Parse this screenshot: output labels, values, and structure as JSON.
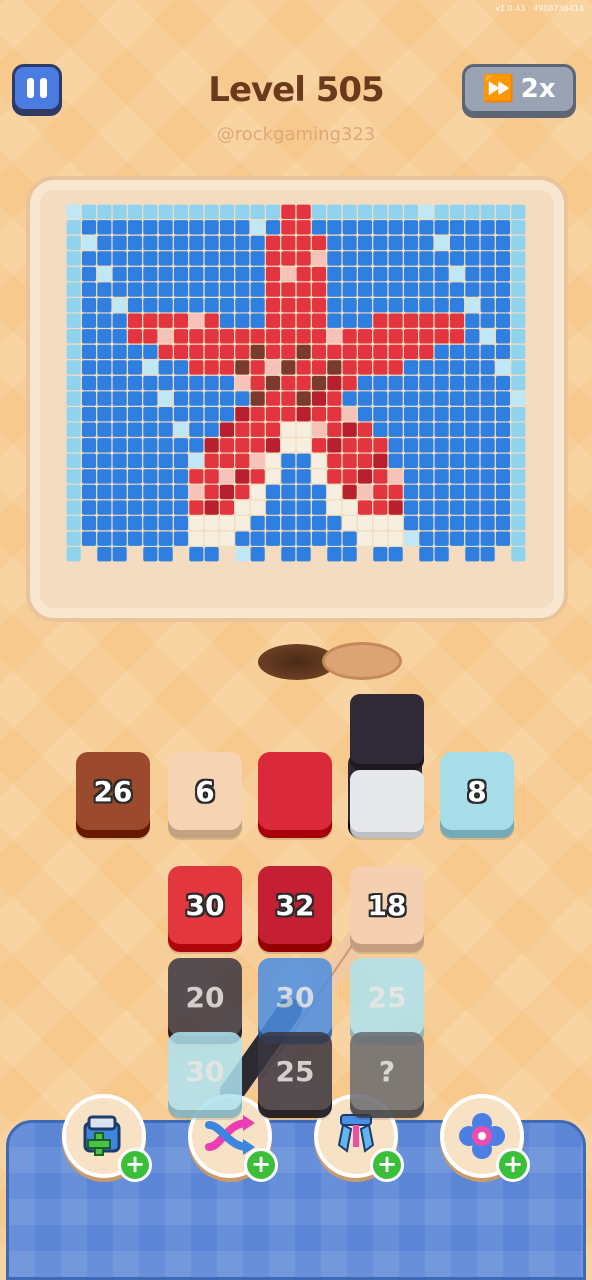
{
  "version": "v1.0.43 · 4908736414",
  "header": {
    "level_title": "Level 505",
    "speed_label": "2x"
  },
  "watermark": "@rockgaming323",
  "queue_tiles": [
    {
      "value": "26",
      "color": "#9b4a2e"
    },
    {
      "value": "6",
      "color": "#f6d3b3"
    },
    {
      "value": "",
      "color": "#d9293a"
    },
    {
      "value": "",
      "color": "#2f2a36"
    },
    {
      "value": "8",
      "color": "#a7dde8"
    }
  ],
  "grid_tiles": [
    {
      "value": "30",
      "color": "#e2373f"
    },
    {
      "value": "32",
      "color": "#c51f33"
    },
    {
      "value": "18",
      "color": "#f5d0b0"
    },
    {
      "value": "20",
      "color": "#3a3642"
    },
    {
      "value": "30",
      "color": "#4c8ee3"
    },
    {
      "value": "25",
      "color": "#aee2f0"
    },
    {
      "value": "30",
      "color": "#aee2f0"
    },
    {
      "value": "25",
      "color": "#3a3642"
    },
    {
      "value": "?",
      "color": "#6b6b70"
    }
  ],
  "boosters": [
    {
      "name": "add-slot",
      "icon": "box-plus-icon"
    },
    {
      "name": "shuffle",
      "icon": "shuffle-arrows-icon"
    },
    {
      "name": "magnet",
      "icon": "magnet-icon"
    },
    {
      "name": "flower",
      "icon": "flower-icon"
    }
  ],
  "colors": {
    "background": "#f7c98c",
    "accent_blue": "#4a7be0",
    "title_brown": "#6b3a1d"
  }
}
